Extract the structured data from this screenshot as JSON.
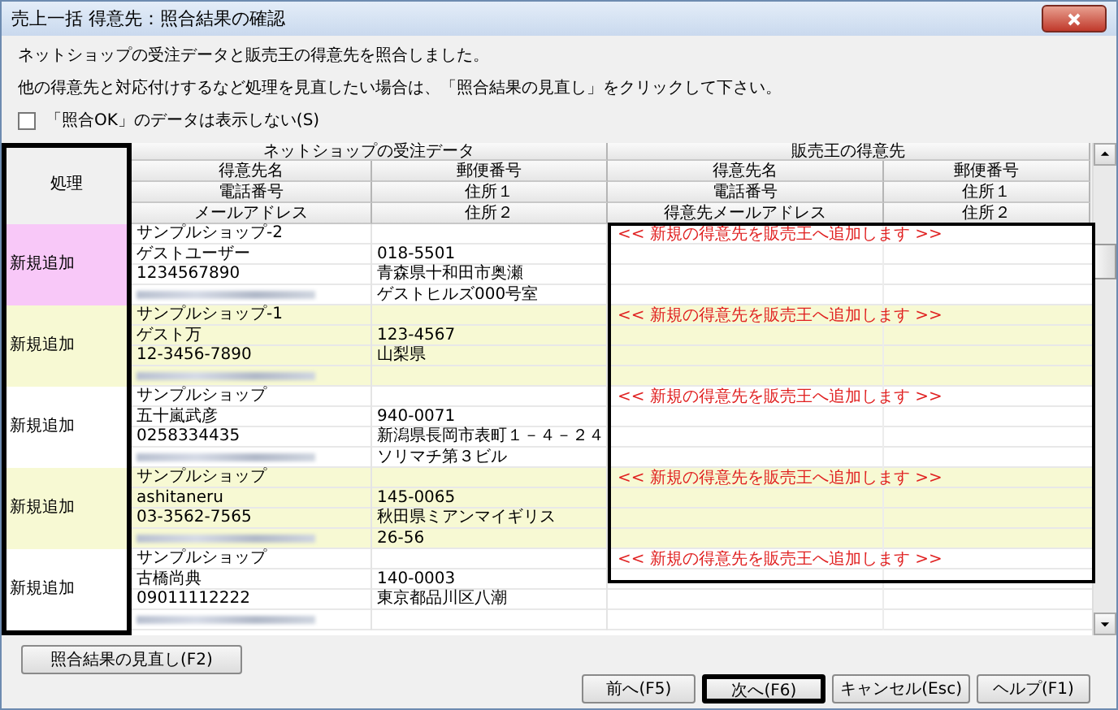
{
  "window": {
    "title": "売上一括 得意先：照合結果の確認"
  },
  "messages": [
    "ネットショップの受注データと販売王の得意先を照合しました。",
    "他の得意先と対応付けするなど処理を見直したい場合は、「照合結果の見直し」をクリックして下さい。"
  ],
  "checkbox": {
    "label": "「照合OK」のデータは表示しない(S)",
    "checked": false
  },
  "table": {
    "process_header": "処理",
    "groups": [
      "ネットショップの受注データ",
      "販売王の得意先"
    ],
    "shop_columns": [
      [
        "得意先名",
        "郵便番号"
      ],
      [
        "電話番号",
        "住所１"
      ],
      [
        "メールアドレス",
        "住所２"
      ]
    ],
    "hanbai_columns": [
      [
        "得意先名",
        "郵便番号"
      ],
      [
        "電話番号",
        "住所１"
      ],
      [
        "得意先メールアドレス",
        "住所２"
      ]
    ],
    "rows": [
      {
        "process": "新規追加",
        "selected": true,
        "shop_name": "サンプルショップ-2",
        "customer": "ゲストユーザー",
        "postal": "018-5501",
        "phone": "1234567890",
        "address1": "青森県十和田市奥瀬",
        "address2": "ゲストヒルズ000号室",
        "match": "<< 新規の得意先を販売王へ追加します >>"
      },
      {
        "process": "新規追加",
        "selected": false,
        "shop_name": "サンプルショップ-1",
        "customer": "ゲスト万",
        "postal": "123-4567",
        "phone": "12-3456-7890",
        "address1": "山梨県",
        "match": "<< 新規の得意先を販売王へ追加します >>"
      },
      {
        "process": "新規追加",
        "selected": false,
        "shop_name": "サンプルショップ",
        "customer": "五十嵐武彦",
        "postal": "940-0071",
        "phone": "0258334435",
        "address1": "新潟県長岡市表町１－４－２４",
        "address2": "ソリマチ第３ビル",
        "match": "<< 新規の得意先を販売王へ追加します >>"
      },
      {
        "process": "新規追加",
        "selected": false,
        "shop_name": "サンプルショップ",
        "customer": "ashitaneru",
        "postal": "145-0065",
        "phone": "03-3562-7565",
        "address1": "秋田県ミアンマイギリス",
        "address2": "26-56",
        "match": "<< 新規の得意先を販売王へ追加します >>"
      },
      {
        "process": "新規追加",
        "selected": false,
        "shop_name": "サンプルショップ",
        "customer": "古橋尚典",
        "postal": "140-0003",
        "phone": "09011112222",
        "address1": "東京都品川区八潮",
        "match": "<< 新規の得意先を販売王へ追加します >>"
      }
    ]
  },
  "buttons": {
    "review": "照合結果の見直し(F2)",
    "actions": [
      {
        "label": "前へ(F5)",
        "focused": false
      },
      {
        "label": "次へ(F6)",
        "focused": true
      },
      {
        "label": "キャンセル(Esc)",
        "focused": false
      },
      {
        "label": "ヘルプ(F1)",
        "focused": false
      }
    ]
  }
}
